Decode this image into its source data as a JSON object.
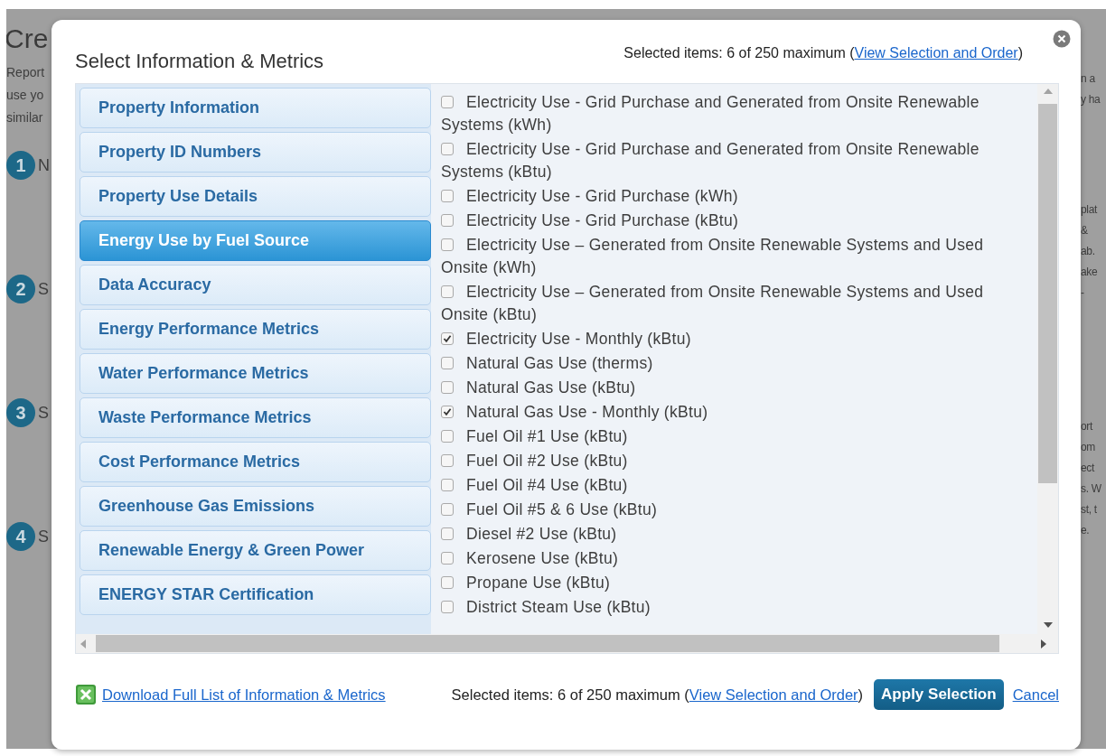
{
  "background": {
    "heading": "Cre",
    "intro_lines": [
      "Report",
      "use yo",
      "similar"
    ],
    "steps": [
      {
        "number": "1",
        "label": "N"
      },
      {
        "number": "2",
        "label": "S"
      },
      {
        "number": "3",
        "label": "S"
      },
      {
        "number": "4",
        "label": "S"
      }
    ],
    "right_fragments": [
      "n a",
      "y ha",
      "plat",
      "&",
      "ab.",
      "ake",
      "-",
      "ort",
      "om",
      "ect",
      "s. W",
      "st, t",
      "e."
    ]
  },
  "dialog": {
    "title": "Select Information & Metrics",
    "selection_summary": {
      "prefix": "Selected items: 6 of 250 maximum (",
      "link": "View Selection and Order",
      "suffix": ")"
    },
    "categories": [
      {
        "label": "Property Information",
        "selected": false
      },
      {
        "label": "Property ID Numbers",
        "selected": false
      },
      {
        "label": "Property Use Details",
        "selected": false
      },
      {
        "label": "Energy Use by Fuel Source",
        "selected": true
      },
      {
        "label": "Data Accuracy",
        "selected": false
      },
      {
        "label": "Energy Performance Metrics",
        "selected": false
      },
      {
        "label": "Water Performance Metrics",
        "selected": false
      },
      {
        "label": "Waste Performance Metrics",
        "selected": false
      },
      {
        "label": "Cost Performance Metrics",
        "selected": false
      },
      {
        "label": "Greenhouse Gas Emissions",
        "selected": false
      },
      {
        "label": "Renewable Energy & Green Power",
        "selected": false
      },
      {
        "label": "ENERGY STAR Certification",
        "selected": false
      }
    ],
    "metrics": [
      {
        "label": "Electricity Use - Grid Purchase and Generated from Onsite Renewable Systems (kWh)",
        "checked": false
      },
      {
        "label": "Electricity Use - Grid Purchase and Generated from Onsite Renewable Systems (kBtu)",
        "checked": false
      },
      {
        "label": "Electricity Use - Grid Purchase (kWh)",
        "checked": false
      },
      {
        "label": "Electricity Use - Grid Purchase (kBtu)",
        "checked": false
      },
      {
        "label": "Electricity Use – Generated from Onsite Renewable Systems and Used Onsite (kWh)",
        "checked": false
      },
      {
        "label": "Electricity Use – Generated from Onsite Renewable Systems and Used Onsite (kBtu)",
        "checked": false
      },
      {
        "label": "Electricity Use - Monthly (kBtu)",
        "checked": true
      },
      {
        "label": "Natural Gas Use (therms)",
        "checked": false
      },
      {
        "label": "Natural Gas Use (kBtu)",
        "checked": false
      },
      {
        "label": "Natural Gas Use - Monthly (kBtu)",
        "checked": true
      },
      {
        "label": "Fuel Oil #1 Use (kBtu)",
        "checked": false
      },
      {
        "label": "Fuel Oil #2 Use (kBtu)",
        "checked": false
      },
      {
        "label": "Fuel Oil #4 Use (kBtu)",
        "checked": false
      },
      {
        "label": "Fuel Oil #5 & 6 Use (kBtu)",
        "checked": false
      },
      {
        "label": "Diesel #2 Use (kBtu)",
        "checked": false
      },
      {
        "label": "Kerosene Use (kBtu)",
        "checked": false
      },
      {
        "label": "Propane Use (kBtu)",
        "checked": false
      },
      {
        "label": "District Steam Use (kBtu)",
        "checked": false
      }
    ],
    "footer": {
      "download_link": "Download Full List of Information & Metrics",
      "selection_summary": {
        "prefix": "Selected items: 6 of 250 maximum (",
        "link": "View Selection and Order",
        "suffix": ")"
      },
      "apply_button": "Apply Selection",
      "cancel_link": "Cancel"
    }
  }
}
